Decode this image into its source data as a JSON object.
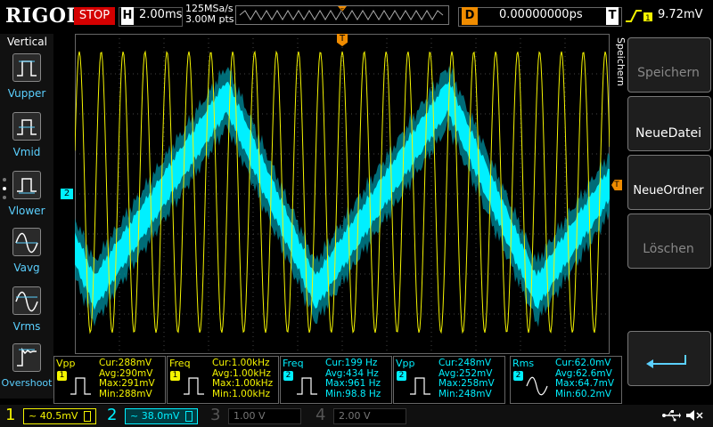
{
  "top": {
    "logo": "RIGOL",
    "run_state": "STOP",
    "timebase_letter": "H",
    "timebase": "2.00ms",
    "sample_rate": "125MSa/s",
    "memory_depth": "3.00M pts",
    "delay_letter": "D",
    "delay": "0.00000000ps",
    "trigger_letter": "T",
    "trigger_level": "9.72mV"
  },
  "left_menu": {
    "title": "Vertical",
    "items": [
      {
        "label": "Vupper",
        "icon": "pulse-top-icon"
      },
      {
        "label": "Vmid",
        "icon": "pulse-mid-icon"
      },
      {
        "label": "Vlower",
        "icon": "pulse-bottom-icon"
      },
      {
        "label": "Vavg",
        "icon": "sine-avg-icon"
      },
      {
        "label": "Vrms",
        "icon": "sine-rms-icon"
      },
      {
        "label": "Overshoot",
        "icon": "overshoot-icon"
      }
    ]
  },
  "right_menu": {
    "title": "Speichern",
    "items": [
      {
        "label": "Speichern",
        "enabled": false
      },
      {
        "label": "NeueDatei",
        "enabled": true
      },
      {
        "label": "NeueOrdner",
        "enabled": true
      },
      {
        "label": "Löschen",
        "enabled": false
      }
    ]
  },
  "markers": {
    "ch2": "2",
    "trigger_pos": "T",
    "trigger_level": "T"
  },
  "measurements": [
    {
      "name": "Vpp",
      "channel": "1",
      "cur": "Cur:288mV",
      "avg": "Avg:290mV",
      "max": "Max:291mV",
      "min": "Min:288mV"
    },
    {
      "name": "Freq",
      "channel": "1",
      "cur": "Cur:1.00kHz",
      "avg": "Avg:1.00kHz",
      "max": "Max:1.00kHz",
      "min": "Min:1.00kHz"
    },
    {
      "name": "Freq",
      "channel": "2",
      "cur": "Cur:199 Hz",
      "avg": "Avg:434 Hz",
      "max": "Max:961 Hz",
      "min": "Min:98.8 Hz"
    },
    {
      "name": "Vpp",
      "channel": "2",
      "cur": "Cur:248mV",
      "avg": "Avg:252mV",
      "max": "Max:258mV",
      "min": "Min:248mV"
    },
    {
      "name": "Rms",
      "channel": "2",
      "cur": "Cur:62.0mV",
      "avg": "Avg:62.6mV",
      "max": "Max:64.7mV",
      "min": "Min:60.2mV"
    }
  ],
  "channels": [
    {
      "num": "1",
      "scale": "~ 40.5mV",
      "color": "#f5f500",
      "active": true
    },
    {
      "num": "2",
      "scale": "~ 38.0mV",
      "color": "#00f0ff",
      "active": true
    },
    {
      "num": "3",
      "scale": "1.00 V",
      "color": "#c050c0",
      "active": false
    },
    {
      "num": "4",
      "scale": "2.00 V",
      "color": "#4060c0",
      "active": false
    }
  ],
  "colors": {
    "ch1": "#f5f500",
    "ch2": "#00f0ff",
    "trigger": "#f08c00",
    "stop": "#d40000"
  }
}
